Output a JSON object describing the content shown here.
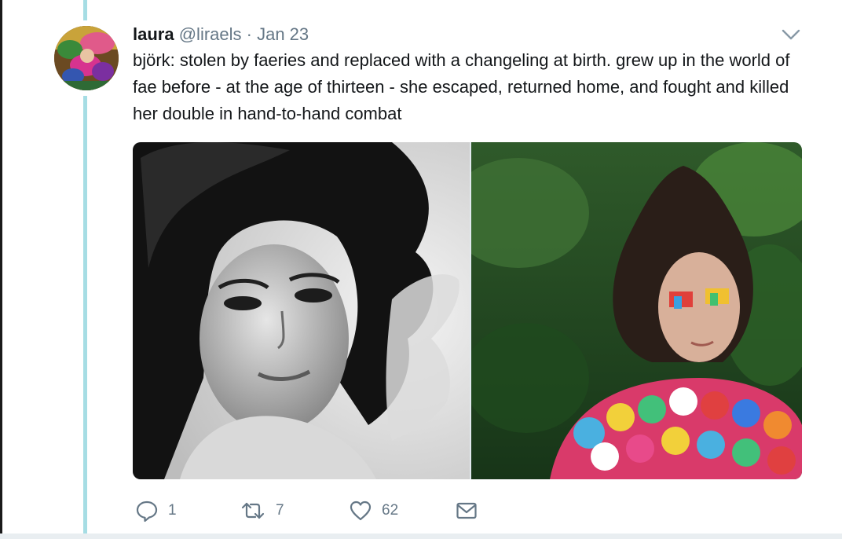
{
  "tweet": {
    "display_name": "laura",
    "handle": "@liraels",
    "separator": "·",
    "date": "Jan 23",
    "text": "björk: stolen by faeries and replaced with a changeling at birth. grew up in the world of fae before - at the age of thirteen - she escaped, returned home, and fought and killed her double in hand-to-hand combat"
  },
  "actions": {
    "reply_count": "1",
    "retweet_count": "7",
    "like_count": "62"
  },
  "icons": {
    "reply": "speech-bubble-icon",
    "retweet": "retweet-arrows-icon",
    "like": "heart-icon",
    "message": "envelope-icon",
    "caret": "chevron-down-icon"
  },
  "colors": {
    "thread_line": "#a6dde4",
    "muted_text": "#657786",
    "primary_text": "#14171a"
  }
}
